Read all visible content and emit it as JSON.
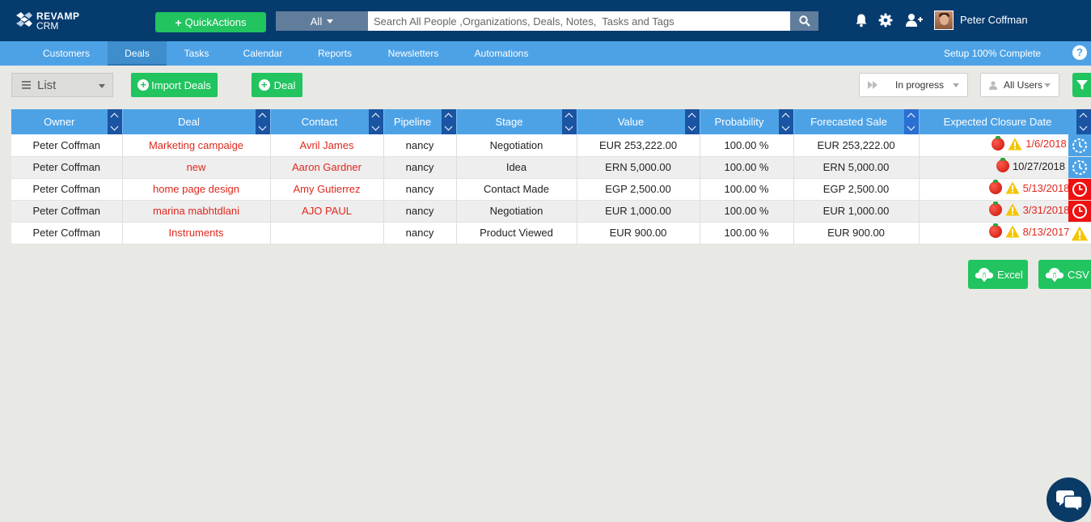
{
  "app": {
    "logo_line1": "REVAMP",
    "logo_line2": "CRM"
  },
  "header": {
    "quick_actions": "QuickActions",
    "search_scope": "All",
    "search_placeholder": "Search All People ,Organizations, Deals, Notes,  Tasks and Tags",
    "user_name": "Peter Coffman"
  },
  "nav": {
    "items": [
      "Customers",
      "Deals",
      "Tasks",
      "Calendar",
      "Reports",
      "Newsletters",
      "Automations"
    ],
    "active": "Deals",
    "setup": "Setup 100% Complete",
    "help": "?"
  },
  "toolbar": {
    "view": "List",
    "import_label": "Import Deals",
    "add_label": "Deal",
    "status_filter": "In progress",
    "user_filter": "All Users"
  },
  "table": {
    "columns": [
      "Owner",
      "Deal",
      "Contact",
      "Pipeline",
      "Stage",
      "Value",
      "Probability",
      "Forecasted Sale",
      "Expected Closure Date"
    ],
    "rows": [
      {
        "owner": "Peter Coffman",
        "deal": "Marketing campaige",
        "contact": "Avril James",
        "pipeline": "nancy",
        "stage": "Negotiation",
        "value": "EUR 253,222.00",
        "probability": "100.00 %",
        "forecast": "EUR 253,222.00",
        "date": "1/6/2018",
        "date_overdue": true,
        "warning": true,
        "status": "clock-pending"
      },
      {
        "owner": "Peter Coffman",
        "deal": "new",
        "contact": "Aaron Gardner",
        "pipeline": "nancy",
        "stage": "Idea",
        "value": "ERN 5,000.00",
        "probability": "100.00 %",
        "forecast": "ERN 5,000.00",
        "date": "10/27/2018",
        "date_overdue": false,
        "warning": false,
        "status": "clock-pending"
      },
      {
        "owner": "Peter Coffman",
        "deal": "home page design",
        "contact": "Amy Gutierrez",
        "pipeline": "nancy",
        "stage": "Contact Made",
        "value": "EGP 2,500.00",
        "probability": "100.00 %",
        "forecast": "EGP 2,500.00",
        "date": "5/13/2018",
        "date_overdue": true,
        "warning": true,
        "status": "clock-overdue"
      },
      {
        "owner": "Peter Coffman",
        "deal": "marina mabhtdlani",
        "contact": "AJO PAUL",
        "pipeline": "nancy",
        "stage": "Negotiation",
        "value": "EUR 1,000.00",
        "probability": "100.00 %",
        "forecast": "EUR 1,000.00",
        "date": "3/31/2018",
        "date_overdue": true,
        "warning": true,
        "status": "clock-overdue"
      },
      {
        "owner": "Peter Coffman",
        "deal": "Instruments",
        "contact": "",
        "pipeline": "nancy",
        "stage": "Product Viewed",
        "value": "EUR 900.00",
        "probability": "100.00 %",
        "forecast": "EUR 900.00",
        "date": "8/13/2017",
        "date_overdue": true,
        "warning": true,
        "status": "warning"
      }
    ]
  },
  "export": {
    "excel": "Excel",
    "csv": "CSV"
  },
  "colors": {
    "header_bg": "#063b6e",
    "nav_bg": "#4da2e6",
    "accent_green": "#21c45f",
    "overdue_red": "#e0281e"
  }
}
